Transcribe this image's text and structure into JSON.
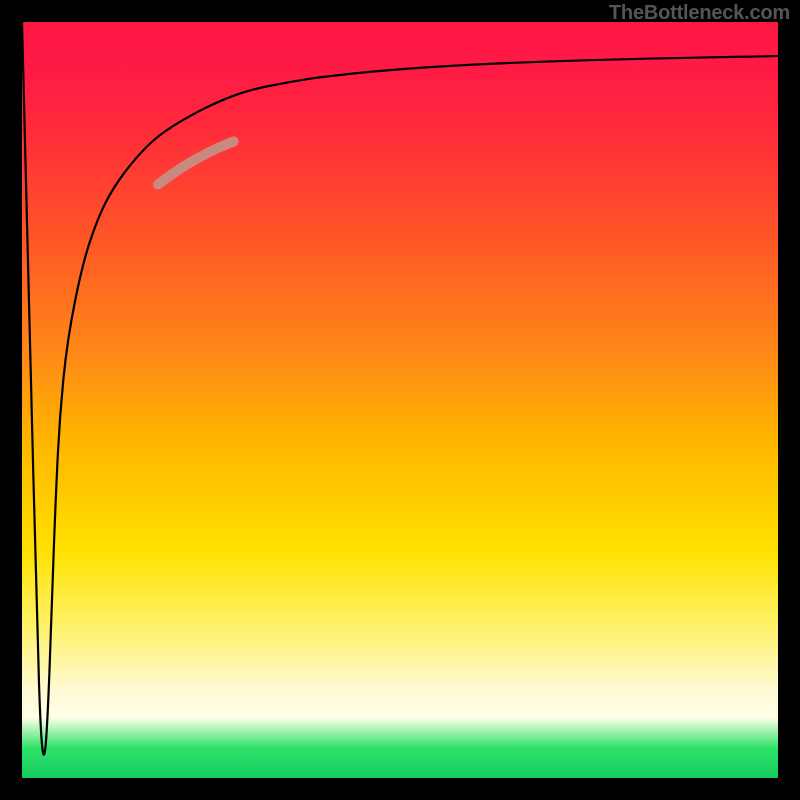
{
  "watermark": "TheBottleneck.com",
  "chart_data": {
    "type": "line",
    "title": "",
    "xlabel": "",
    "ylabel": "",
    "xlim": [
      0,
      100
    ],
    "ylim": [
      0,
      100
    ],
    "grid": false,
    "legend": "none",
    "series": [
      {
        "name": "bottleneck-curve",
        "color": "#000000",
        "x": [
          0,
          1,
          2,
          2.5,
          3,
          3.5,
          4,
          4.5,
          5,
          6,
          8,
          10,
          12,
          15,
          18,
          22,
          26,
          30,
          35,
          40,
          50,
          60,
          70,
          80,
          90,
          100
        ],
        "y": [
          100,
          60,
          20,
          5,
          2,
          10,
          25,
          38,
          48,
          58,
          68,
          74,
          78,
          82,
          85,
          87.5,
          89.5,
          91,
          92,
          92.8,
          93.8,
          94.4,
          94.8,
          95.1,
          95.3,
          95.5
        ]
      },
      {
        "name": "highlight-segment",
        "color": "#c9897f",
        "x": [
          18,
          20,
          22,
          24,
          26,
          28
        ],
        "y": [
          78.5,
          80,
          81.3,
          82.4,
          83.4,
          84.2
        ]
      }
    ],
    "background_gradient": {
      "direction": "top-to-bottom",
      "stops": [
        {
          "pos": 0.0,
          "color": "#ff1744"
        },
        {
          "pos": 0.3,
          "color": "#ff5a25"
        },
        {
          "pos": 0.55,
          "color": "#ffb400"
        },
        {
          "pos": 0.8,
          "color": "#fff26a"
        },
        {
          "pos": 0.92,
          "color": "#ffffe8"
        },
        {
          "pos": 1.0,
          "color": "#14cc60"
        }
      ]
    }
  }
}
